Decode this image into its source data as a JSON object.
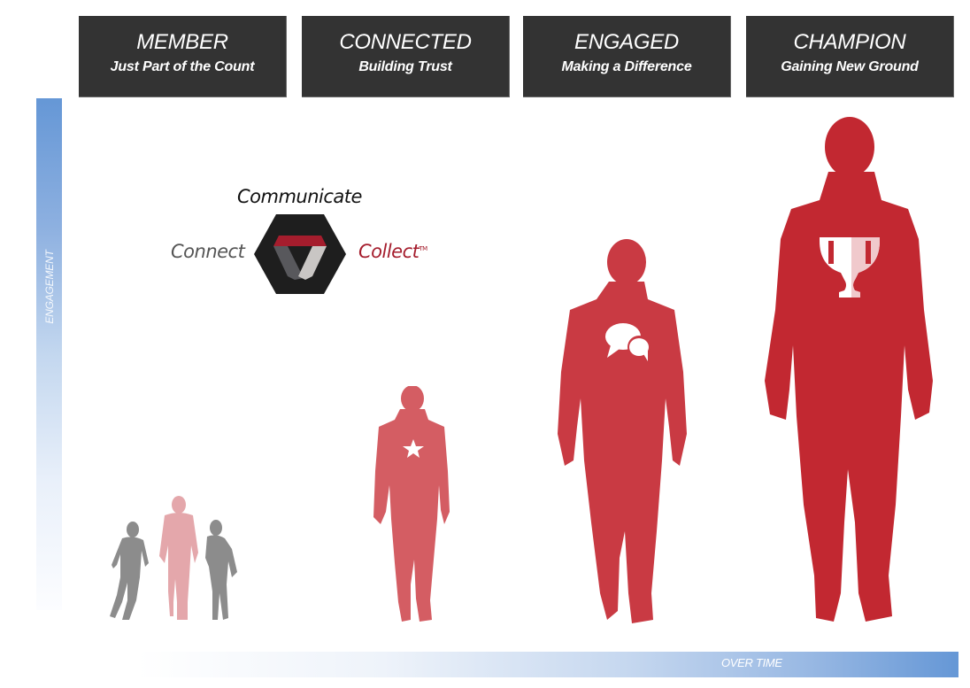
{
  "stages": [
    {
      "title": "MEMBER",
      "subtitle": "Just Part of the Count"
    },
    {
      "title": "CONNECTED",
      "subtitle": "Building Trust"
    },
    {
      "title": "ENGAGED",
      "subtitle": "Making a Difference"
    },
    {
      "title": "CHAMPION",
      "subtitle": "Gaining New Ground"
    }
  ],
  "logo": {
    "top_word": "Communicate",
    "left_word": "Connect",
    "right_word": "Collect",
    "trademark": "TM"
  },
  "axes": {
    "y_label": "ENGAGEMENT",
    "x_label": "OVER TIME"
  },
  "figures": [
    {
      "stage": "MEMBER",
      "icon": "none",
      "description": "group of three people (two gray, one light pink)"
    },
    {
      "stage": "CONNECTED",
      "icon": "star-icon"
    },
    {
      "stage": "ENGAGED",
      "icon": "speech-bubbles-icon"
    },
    {
      "stage": "CHAMPION",
      "icon": "trophy-icon"
    }
  ],
  "colors": {
    "header_bg": "#333333",
    "axis_blue": "#6597d6",
    "brand_red": "#a51d2d",
    "member_gray": "#8c8c8c",
    "member_pink": "#e4a7ab",
    "connected_red": "#d45d63",
    "engaged_red": "#c93a43",
    "champion_red": "#c22831"
  }
}
